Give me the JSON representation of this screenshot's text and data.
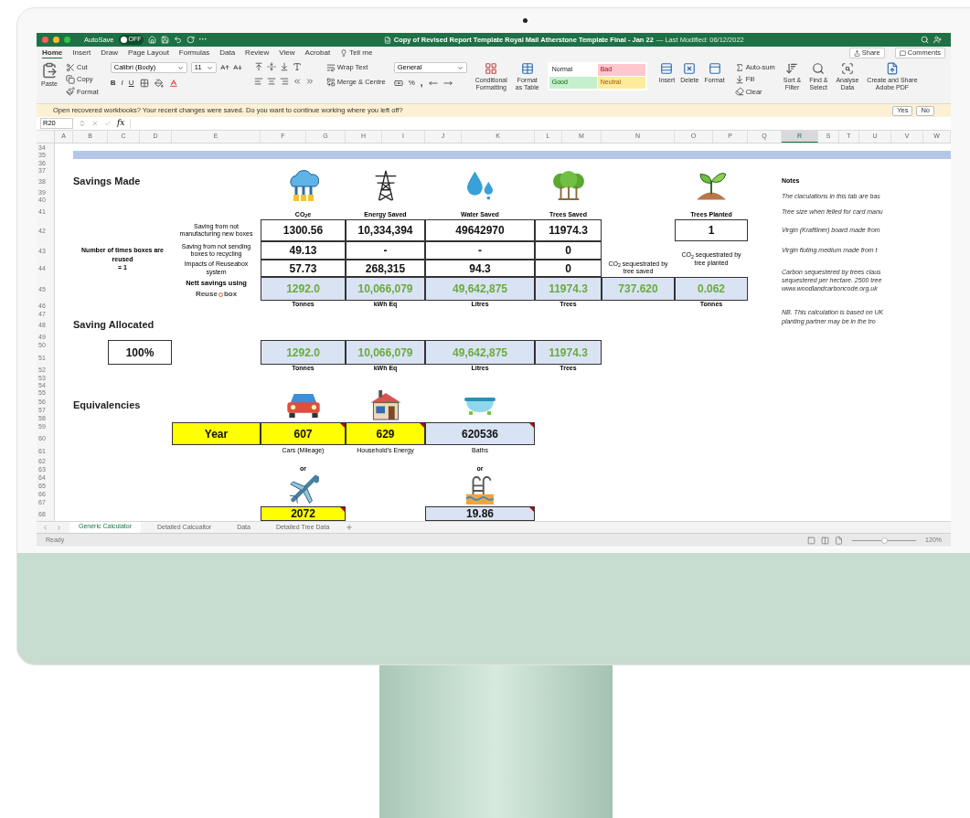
{
  "title_bar": {
    "autosave_label": "AutoSave",
    "autosave": {
      "on": false,
      "label": "OFF"
    },
    "more": "···",
    "title": "Copy of Revised Report Template Royal Mail Atherstone Template Final - Jan 22",
    "modified": "— Last Modified: 06/12/2022"
  },
  "menu_tabs": [
    {
      "label": "Home",
      "selected": true
    },
    {
      "label": "Insert",
      "selected": false
    },
    {
      "label": "Draw",
      "selected": false
    },
    {
      "label": "Page Layout",
      "selected": false
    },
    {
      "label": "Formulas",
      "selected": false
    },
    {
      "label": "Data",
      "selected": false
    },
    {
      "label": "Review",
      "selected": false
    },
    {
      "label": "View",
      "selected": false
    },
    {
      "label": "Acrobat",
      "selected": false
    }
  ],
  "tell_me": "Tell me",
  "share": "Share",
  "comments": "Comments",
  "ribbon": {
    "paste": "Paste",
    "cut": "Cut",
    "copy": "Copy",
    "format_painter": "Format",
    "font": "Calibri (Body)",
    "size": "11",
    "text_styles": [
      "B",
      "I",
      "U"
    ],
    "wrap_text": "Wrap Text",
    "merge": "Merge & Centre",
    "number_format": "General",
    "percent": "%",
    "comma": ",",
    "conditional": [
      "Conditional",
      "Formatting"
    ],
    "format_table": [
      "Format",
      "as Table"
    ],
    "styles": [
      {
        "label": "Normal",
        "color": "#ffffff"
      },
      {
        "label": "Bad",
        "color": "#ffc7ce"
      },
      {
        "label": "Good",
        "color": "#c6efce"
      },
      {
        "label": "Neutral",
        "color": "#ffeb9c"
      }
    ],
    "cells": [
      "Insert",
      "Delete",
      "Format"
    ],
    "autosum": "Auto-sum",
    "fill": "Fill",
    "clear": "Clear",
    "sort": [
      "Sort &",
      "Filter"
    ],
    "find": [
      "Find &",
      "Select"
    ],
    "analyse": [
      "Analyse",
      "Data"
    ],
    "adobe": [
      "Create and Share",
      "Adobe PDF"
    ]
  },
  "notification": {
    "message": "Open recovered workbooks?  Your recent changes were saved. Do you want to continue working where you left off?",
    "yes": "Yes",
    "no": "No"
  },
  "formula_bar": {
    "cell": "R20",
    "fx": "fx"
  },
  "col_headers": [
    {
      "label": "A",
      "selected": false
    },
    {
      "label": "B",
      "selected": false
    },
    {
      "label": "C",
      "selected": false
    },
    {
      "label": "D",
      "selected": false
    },
    {
      "label": "E",
      "selected": false
    },
    {
      "label": "F",
      "selected": false
    },
    {
      "label": "G",
      "selected": false
    },
    {
      "label": "H",
      "selected": false
    },
    {
      "label": "I",
      "selected": false
    },
    {
      "label": "J",
      "selected": false
    },
    {
      "label": "K",
      "selected": false
    },
    {
      "label": "L",
      "selected": false
    },
    {
      "label": "M",
      "selected": false
    },
    {
      "label": "N",
      "selected": false
    },
    {
      "label": "O",
      "selected": false
    },
    {
      "label": "P",
      "selected": false
    },
    {
      "label": "Q",
      "selected": false
    },
    {
      "label": "R",
      "selected": true
    },
    {
      "label": "S",
      "selected": false
    },
    {
      "label": "T",
      "selected": false
    },
    {
      "label": "U",
      "selected": false
    },
    {
      "label": "V",
      "selected": false
    },
    {
      "label": "W",
      "selected": false
    }
  ],
  "row_numbers": [
    "34",
    "35",
    "36",
    "37",
    "38",
    "39",
    "40",
    "41",
    "42",
    "43",
    "44",
    "45",
    "46",
    "47",
    "48",
    "49",
    "50",
    "51",
    "52",
    "53",
    "54",
    "55",
    "56",
    "57",
    "58",
    "59",
    "60",
    "61",
    "62",
    "63",
    "64",
    "65",
    "66",
    "67",
    "68"
  ],
  "savings_made": {
    "title": "Savings Made",
    "headers": [
      "CO$_{2}$e",
      "Energy Saved",
      "Water Saved",
      "Trees Saved"
    ],
    "row_labels": [
      "Saving from not manufacturing new boxes",
      "Saving from not sending boxes to recycling",
      "Impacts of Reuseabox system"
    ],
    "rows": [
      [
        "1300.56",
        "10,334,394",
        "49642970",
        "11974.3"
      ],
      [
        "49.13",
        "-",
        "-",
        "0"
      ],
      [
        "57.73",
        "268,315",
        "94.3",
        "0"
      ]
    ],
    "nett_label": "Nett savings using",
    "logo": {
      "left": "Reuse",
      "right": "box"
    },
    "nett": [
      "1292.0",
      "10,066,079",
      "49,642,875",
      "11974.3"
    ],
    "units": [
      "Tonnes",
      "kWh Eq",
      "Litres",
      "Trees"
    ],
    "reuse_label": "Number of times boxes are reused",
    "reuse_value": "= 1",
    "seq_saved_label": "CO$_{2}$ sequestrated by tree saved",
    "seq_saved": "737.620",
    "planted_header": "Trees Planted",
    "planted": "1",
    "seq_planted_label": "CO$_{2}$ sequestrated by tree planted",
    "seq_planted": "0.062",
    "planted_unit": "Tonnes"
  },
  "notes": {
    "title": "Notes",
    "paragraphs": [
      [
        "The claculations in this tab are bas"
      ],
      [
        "Tree size when felled for card manu"
      ],
      [
        "Virgin (Kraftliner) board made from"
      ],
      [
        "Virgin fluting medium made from t"
      ],
      [
        "Carbon sequestered by trees claus",
        "sequestered per hectare. 2500 tree",
        "www.woodlandcarboncode.org.uk"
      ],
      [
        "NB. This calculation is based on UK",
        "planting partner may be in the tro"
      ]
    ]
  },
  "saving_allocated": {
    "title": "Saving Allocated",
    "percent": "100%",
    "values": [
      "1292.0",
      "10,066,079",
      "49,642,875",
      "11974.3"
    ],
    "units": [
      "Tonnes",
      "kWh Eq",
      "Litres",
      "Trees"
    ]
  },
  "equivalencies": {
    "title": "Equivalencies",
    "year_label": "Year",
    "items": [
      {
        "value": "607",
        "label": "Cars (Mileage)",
        "highlight": true,
        "comment": true
      },
      {
        "value": "629",
        "label": "Household's Energy",
        "highlight": true,
        "comment": true
      },
      {
        "value": "620536",
        "label": "Baths",
        "highlight": false,
        "comment": true
      }
    ],
    "alternatives": [
      {
        "or": "or",
        "value": "2072",
        "highlight": true,
        "comment": true
      },
      {
        "or": "or",
        "value": "19.86",
        "highlight": false,
        "comment": true
      }
    ]
  },
  "sheet_tabs": [
    {
      "label": "Generic Calculator",
      "selected": true
    },
    {
      "label": "Detailed Calcualtor",
      "selected": false
    },
    {
      "label": "Data",
      "selected": false
    },
    {
      "label": "Detailed Tree Data",
      "selected": false
    }
  ],
  "status_bar": {
    "status": "Ready",
    "zoom": "120%",
    "level": 0.5
  }
}
